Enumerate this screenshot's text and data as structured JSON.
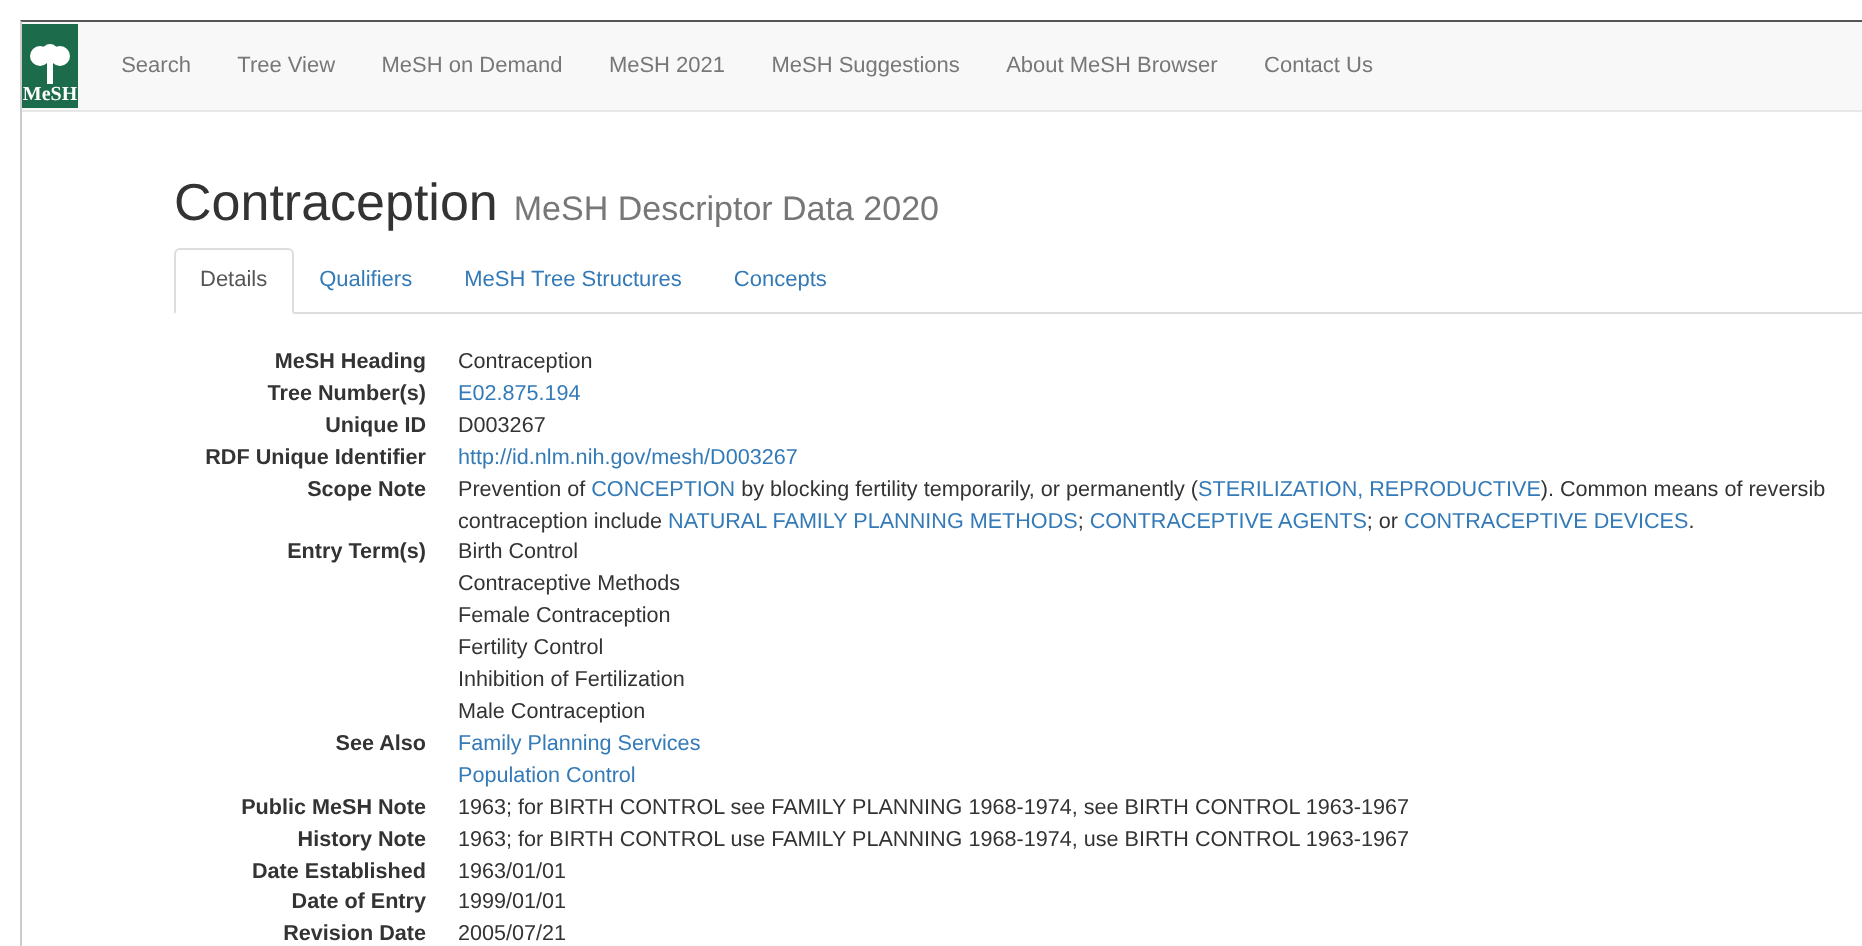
{
  "nav": {
    "logo": "MeSH",
    "items": [
      "Search",
      "Tree View",
      "MeSH on Demand",
      "MeSH 2021",
      "MeSH Suggestions",
      "About MeSH Browser",
      "Contact Us"
    ]
  },
  "title": "Contraception",
  "subtitle": "MeSH Descriptor Data 2020",
  "tabs": [
    {
      "label": "Details",
      "selected": true
    },
    {
      "label": "Qualifiers",
      "selected": false
    },
    {
      "label": "MeSH Tree Structures",
      "selected": false
    },
    {
      "label": "Concepts",
      "selected": false
    }
  ],
  "rows": [
    {
      "label": "MeSH Heading",
      "lines": [
        [
          {
            "text": "Contraception",
            "link": false
          }
        ]
      ]
    },
    {
      "label": "Tree Number(s)",
      "lines": [
        [
          {
            "text": "E02.875.194",
            "link": true
          }
        ]
      ]
    },
    {
      "label": "Unique ID",
      "lines": [
        [
          {
            "text": "D003267",
            "link": false
          }
        ]
      ]
    },
    {
      "label": "RDF Unique Identifier",
      "lines": [
        [
          {
            "text": "http://id.nlm.nih.gov/mesh/D003267",
            "link": true
          }
        ]
      ]
    },
    {
      "label": "Scope Note",
      "lines": [
        [
          {
            "text": "Prevention of ",
            "link": false
          },
          {
            "text": "CONCEPTION",
            "link": true
          },
          {
            "text": " by blocking fertility temporarily, or permanently (",
            "link": false
          },
          {
            "text": "STERILIZATION, REPRODUCTIVE",
            "link": true
          },
          {
            "text": "). Common means of reversib",
            "link": false
          }
        ],
        [
          {
            "text": "contraception include ",
            "link": false
          },
          {
            "text": "NATURAL FAMILY PLANNING METHODS",
            "link": true
          },
          {
            "text": "; ",
            "link": false
          },
          {
            "text": "CONTRACEPTIVE AGENTS",
            "link": true
          },
          {
            "text": "; or ",
            "link": false
          },
          {
            "text": "CONTRACEPTIVE DEVICES",
            "link": true
          },
          {
            "text": ".",
            "link": false
          }
        ]
      ]
    },
    {
      "label": "Entry Term(s)",
      "lines": [
        [
          {
            "text": "Birth Control",
            "link": false
          }
        ],
        [
          {
            "text": "Contraceptive Methods",
            "link": false
          }
        ],
        [
          {
            "text": "Female Contraception",
            "link": false
          }
        ],
        [
          {
            "text": "Fertility Control",
            "link": false
          }
        ],
        [
          {
            "text": "Inhibition of Fertilization",
            "link": false
          }
        ],
        [
          {
            "text": "Male Contraception",
            "link": false
          }
        ]
      ]
    },
    {
      "label": "See Also",
      "lines": [
        [
          {
            "text": "Family Planning Services",
            "link": true
          }
        ],
        [
          {
            "text": "Population Control",
            "link": true
          }
        ]
      ]
    },
    {
      "label": "Public MeSH Note",
      "lines": [
        [
          {
            "text": "1963; for BIRTH CONTROL see FAMILY PLANNING 1968-1974, see BIRTH CONTROL 1963-1967",
            "link": false
          }
        ]
      ]
    },
    {
      "label": "History Note",
      "lines": [
        [
          {
            "text": "1963; for BIRTH CONTROL use FAMILY PLANNING 1968-1974, use BIRTH CONTROL 1963-1967",
            "link": false
          }
        ]
      ]
    },
    {
      "label": "Date Established",
      "lines": [
        [
          {
            "text": "1963/01/01",
            "link": false
          }
        ]
      ]
    },
    {
      "label": "Date of Entry",
      "lines": [
        [
          {
            "text": "1999/01/01",
            "link": false
          }
        ]
      ]
    },
    {
      "label": "Revision Date",
      "lines": [
        [
          {
            "text": "2005/07/21",
            "link": false
          }
        ]
      ]
    }
  ]
}
